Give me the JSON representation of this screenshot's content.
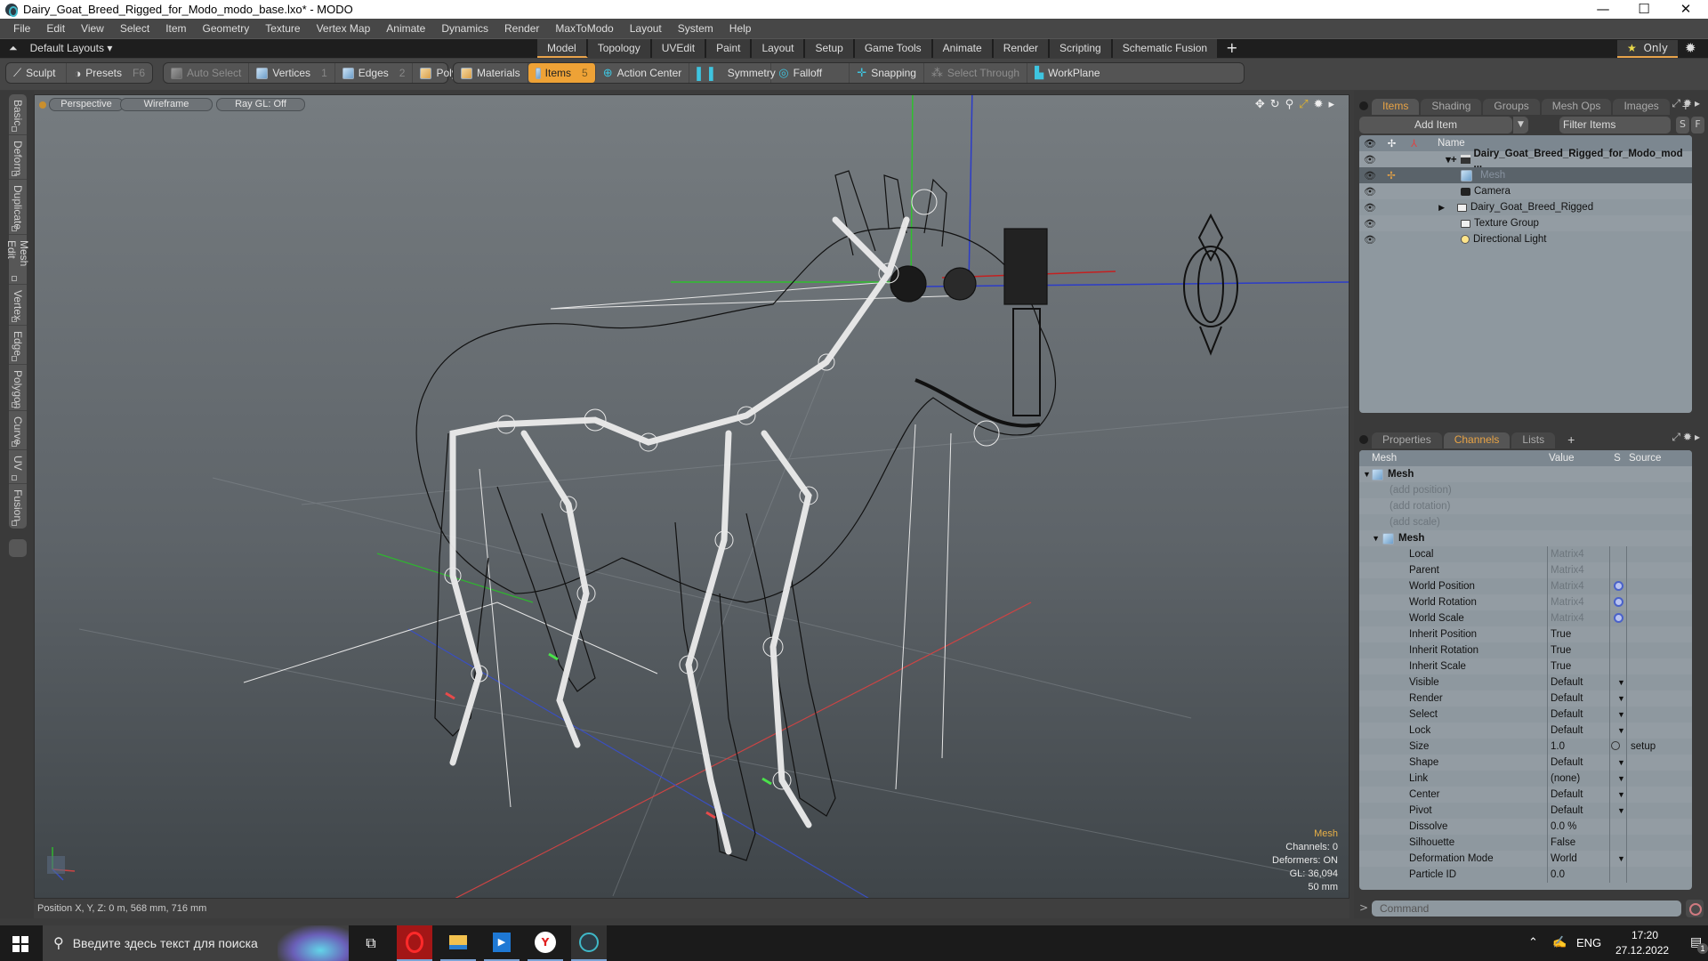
{
  "window": {
    "title": "Dairy_Goat_Breed_Rigged_for_Modo_modo_base.lxo* - MODO",
    "controls": {
      "minimize": "—",
      "maximize": "☐",
      "close": "✕"
    }
  },
  "menubar": [
    "File",
    "Edit",
    "View",
    "Select",
    "Item",
    "Geometry",
    "Texture",
    "Vertex Map",
    "Animate",
    "Dynamics",
    "Render",
    "MaxToModo",
    "Layout",
    "System",
    "Help"
  ],
  "layoutbar": {
    "layouts_label": "Default Layouts ▾",
    "tabs": [
      "Model",
      "Topology",
      "UVEdit",
      "Paint",
      "Layout",
      "Setup",
      "Game Tools",
      "Animate",
      "Render",
      "Scripting",
      "Schematic Fusion"
    ],
    "active_tab": "Model",
    "add_tab": "+",
    "only_label": "Only",
    "only_star": "★"
  },
  "toolbar": {
    "sculpt": "Sculpt",
    "presets": "Presets",
    "presets_key": "F6",
    "auto_select": "Auto Select",
    "vertices": "Vertices",
    "vertices_key": "1",
    "edges": "Edges",
    "edges_key": "2",
    "polygons": "Polygons",
    "materials": "Materials",
    "items": "Items",
    "items_key": "5",
    "action_center": "Action Center",
    "symmetry": "Symmetry",
    "falloff": "Falloff",
    "snapping": "Snapping",
    "select_through": "Select Through",
    "workplane": "WorkPlane"
  },
  "left_tabs": [
    "Basic",
    "Deform",
    "Duplicate",
    "Mesh Edit",
    "Vertex",
    "Edge",
    "Polygon",
    "Curve",
    "UV",
    "Fusion"
  ],
  "viewport": {
    "view_mode": "Perspective",
    "shading": "Wireframe",
    "raygl": "Ray GL: Off",
    "info": {
      "selection": "Mesh",
      "channels": "Channels: 0",
      "deformers": "Deformers: ON",
      "gl": "GL: 36,094",
      "unit": "50 mm"
    }
  },
  "statusbar": {
    "position": "Position X, Y, Z:   0 m, 568 mm, 716 mm"
  },
  "items_panel": {
    "tabs": [
      "Items",
      "Shading",
      "Groups",
      "Mesh Ops",
      "Images"
    ],
    "active_tab": "Items",
    "add_item": "Add Item",
    "filter_placeholder": "Filter Items",
    "s_btn": "S",
    "f_btn": "F",
    "column_name": "Name",
    "items": [
      {
        "name": "Dairy_Goat_Breed_Rigged_for_Modo_mod ...",
        "type": "scene",
        "bold": true
      },
      {
        "name": "Mesh",
        "type": "mesh",
        "selected": true
      },
      {
        "name": "Camera",
        "type": "camera"
      },
      {
        "name": "Dairy_Goat_Breed_Rigged",
        "type": "group"
      },
      {
        "name": "Texture Group",
        "type": "group"
      },
      {
        "name": "Directional Light",
        "type": "light"
      }
    ]
  },
  "channels_panel": {
    "tabs": [
      "Properties",
      "Channels",
      "Lists"
    ],
    "active_tab": "Channels",
    "columns": [
      "Mesh",
      "Value",
      "S",
      "Source"
    ],
    "root": "Mesh",
    "add_rows": [
      "(add position)",
      "(add rotation)",
      "(add scale)"
    ],
    "group": "Mesh",
    "channels": [
      {
        "name": "Local",
        "value": "Matrix4",
        "dim": true
      },
      {
        "name": "Parent",
        "value": "Matrix4",
        "dim": true
      },
      {
        "name": "World Position",
        "value": "Matrix4",
        "dim": true,
        "s": "gear"
      },
      {
        "name": "World Rotation",
        "value": "Matrix4",
        "dim": true,
        "s": "gear"
      },
      {
        "name": "World Scale",
        "value": "Matrix4",
        "dim": true,
        "s": "gear"
      },
      {
        "name": "Inherit Position",
        "value": "True"
      },
      {
        "name": "Inherit Rotation",
        "value": "True"
      },
      {
        "name": "Inherit Scale",
        "value": "True"
      },
      {
        "name": "Visible",
        "value": "Default",
        "dropdown": true
      },
      {
        "name": "Render",
        "value": "Default",
        "dropdown": true
      },
      {
        "name": "Select",
        "value": "Default",
        "dropdown": true
      },
      {
        "name": "Lock",
        "value": "Default",
        "dropdown": true
      },
      {
        "name": "Size",
        "value": "1.0",
        "s": "radio",
        "source": "setup"
      },
      {
        "name": "Shape",
        "value": "Default",
        "dropdown": true
      },
      {
        "name": "Link",
        "value": "(none)",
        "dropdown": true
      },
      {
        "name": "Center",
        "value": "Default",
        "dropdown": true
      },
      {
        "name": "Pivot",
        "value": "Default",
        "dropdown": true
      },
      {
        "name": "Dissolve",
        "value": "0.0 %"
      },
      {
        "name": "Silhouette",
        "value": "False"
      },
      {
        "name": "Deformation Mode",
        "value": "World",
        "dropdown": true
      },
      {
        "name": "Particle ID",
        "value": "0.0"
      }
    ]
  },
  "command": {
    "prompt": ">",
    "placeholder": "Command"
  },
  "taskbar": {
    "search_placeholder": "Введите здесь текст для поиска",
    "apps": [
      "task-view",
      "opera",
      "file-explorer",
      "media-player",
      "yandex-browser",
      "modo"
    ],
    "lang": "ENG",
    "time": "17:20",
    "date": "27.12.2022",
    "notifications": "1"
  }
}
